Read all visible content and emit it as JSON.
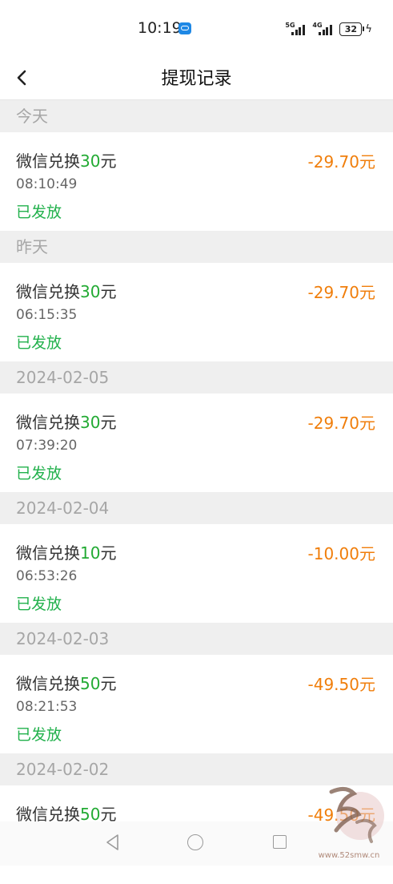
{
  "status_bar": {
    "time": "10:19",
    "network1": "5G",
    "network2": "4G",
    "battery": "32",
    "icons": [
      "message-icon",
      "signal-icon",
      "battery-icon",
      "charging-icon"
    ]
  },
  "header": {
    "title": "提现记录",
    "back_icon": "chevron-left-icon"
  },
  "groups": [
    {
      "date": "今天",
      "record": {
        "prefix": "微信兑换",
        "num": "30",
        "suffix": "元",
        "time": "08:10:49",
        "status": "已发放",
        "amount": "-29.70元"
      }
    },
    {
      "date": "昨天",
      "record": {
        "prefix": "微信兑换",
        "num": "30",
        "suffix": "元",
        "time": "06:15:35",
        "status": "已发放",
        "amount": "-29.70元"
      }
    },
    {
      "date": "2024-02-05",
      "record": {
        "prefix": "微信兑换",
        "num": "30",
        "suffix": "元",
        "time": "07:39:20",
        "status": "已发放",
        "amount": "-29.70元"
      }
    },
    {
      "date": "2024-02-04",
      "record": {
        "prefix": "微信兑换",
        "num": "10",
        "suffix": "元",
        "time": "06:53:26",
        "status": "已发放",
        "amount": "-10.00元"
      }
    },
    {
      "date": "2024-02-03",
      "record": {
        "prefix": "微信兑换",
        "num": "50",
        "suffix": "元",
        "time": "08:21:53",
        "status": "已发放",
        "amount": "-49.50元"
      }
    },
    {
      "date": "2024-02-02",
      "record": {
        "prefix": "微信兑换",
        "num": "50",
        "suffix": "元",
        "time": "",
        "status": "",
        "amount": "-49.50元"
      }
    }
  ],
  "colors": {
    "amount": "#f07e0b",
    "status": "#22b14c",
    "highlight": "#22aa33",
    "date_header_bg": "#efefef"
  },
  "nav_bar": {
    "icons": [
      "nav-back-icon",
      "nav-home-icon",
      "nav-recent-icon"
    ]
  },
  "watermark": {
    "text": "www.52smw.cn"
  }
}
